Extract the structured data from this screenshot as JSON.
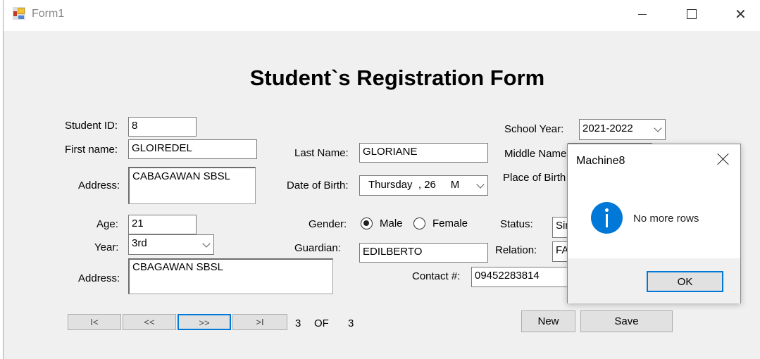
{
  "window": {
    "title": "Form1",
    "minimize": "—",
    "close": "✕"
  },
  "form": {
    "heading": "Student`s Registration Form",
    "student_id": {
      "label": "Student ID:",
      "value": "8"
    },
    "first_name": {
      "label": "First name:",
      "value": "GLOIREDEL"
    },
    "address1": {
      "label": "Address:",
      "value": "CABAGAWAN SBSL"
    },
    "last_name": {
      "label": "Last Name:",
      "value": "GLORIANE"
    },
    "dob": {
      "label": "Date of Birth:",
      "value": "Thursday  , 26     M"
    },
    "school_year": {
      "label": "School Year:",
      "value": "2021-2022"
    },
    "middle_name": {
      "label": "Middle Name"
    },
    "place_of_birth": {
      "label": "Place of Birth"
    },
    "age": {
      "label": "Age:",
      "value": "21"
    },
    "year": {
      "label": "Year:",
      "value": "3rd"
    },
    "address2": {
      "label": "Address:",
      "value": "CBAGAWAN SBSL"
    },
    "gender": {
      "label": "Gender:",
      "options": [
        "Male",
        "Female"
      ],
      "selected": "Male"
    },
    "guardian": {
      "label": "Guardian:",
      "value": "EDILBERTO"
    },
    "status": {
      "label": "Status:",
      "value": "Sin"
    },
    "relation": {
      "label": "Relation:",
      "value": "FA"
    },
    "contact": {
      "label": "Contact #:",
      "value": "09452283814"
    }
  },
  "nav": {
    "first": "I<",
    "prev": "<<",
    "next": ">>",
    "last": ">I",
    "current": "3",
    "of": "OF",
    "total": "3"
  },
  "actions": {
    "new": "New",
    "save": "Save"
  },
  "dialog": {
    "title": "Machine8",
    "message": "No more rows",
    "ok": "OK",
    "icon": "info-icon",
    "icon_color": "#0078d7"
  }
}
